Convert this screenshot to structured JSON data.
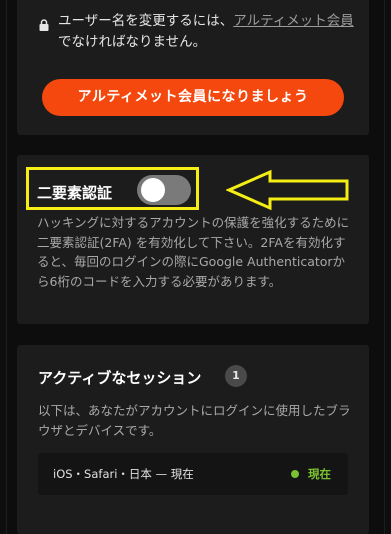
{
  "username_notice": {
    "text_before": "ユーザー名を変更するには、",
    "link_text": "アルティメット会員",
    "text_after": "でなければなりません。"
  },
  "upgrade_button_label": "アルティメット会員になりましょう",
  "two_factor": {
    "title": "二要素認証",
    "enabled": false,
    "description": "ハッキングに対するアカウントの保護を強化するために二要素認証(2FA) を有効化して下さい。2FAを有効化すると、毎回のログインの際にGoogle Authenticatorから6桁のコードを入力する必要があります。"
  },
  "sessions": {
    "title": "アクティブなセッション",
    "count": "1",
    "description": "以下は、あなたがアカウントにログインに使用したブラウザとデバイスです。",
    "items": [
      {
        "info": "iOS・Safari・日本 — 現在",
        "status": "現在"
      }
    ]
  },
  "colors": {
    "accent": "#f4480e",
    "highlight": "#f4ee14",
    "status_active": "#7ac231"
  }
}
